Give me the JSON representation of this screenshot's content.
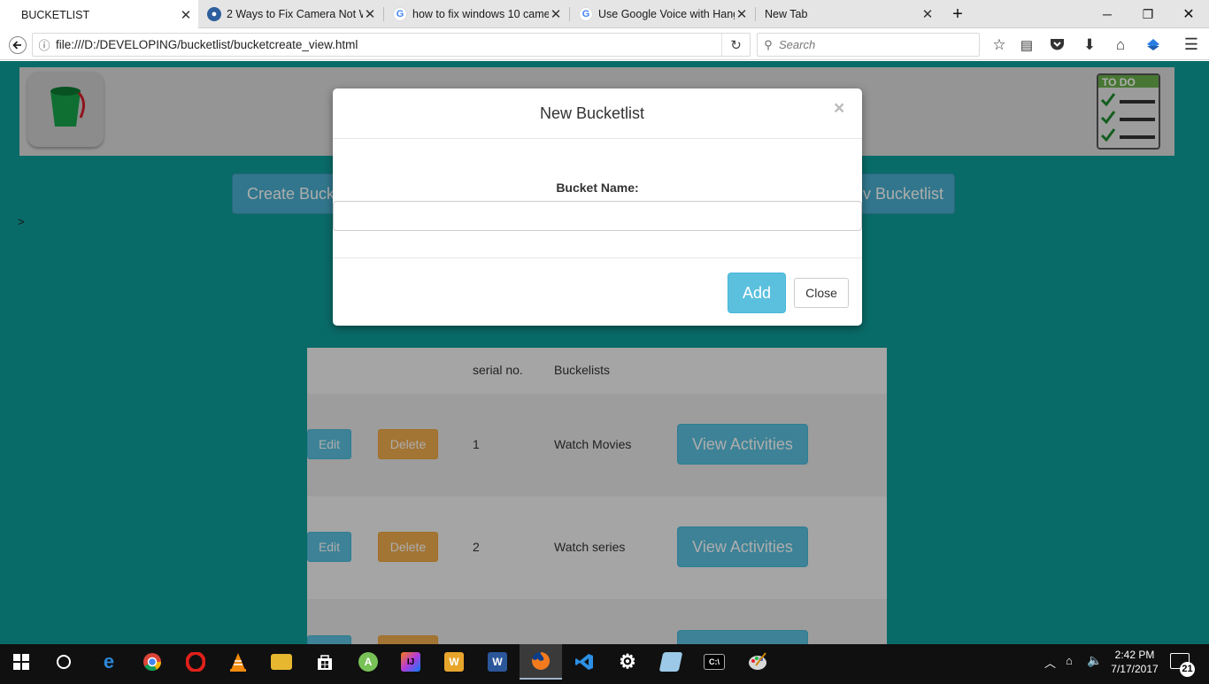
{
  "browser": {
    "tabs": [
      {
        "title": "BUCKETLIST",
        "active": true
      },
      {
        "title": "2 Ways to Fix Camera Not W",
        "active": false
      },
      {
        "title": "how to fix windows 10 came",
        "active": false
      },
      {
        "title": "Use Google Voice with Hang",
        "active": false
      },
      {
        "title": "New Tab",
        "active": false
      }
    ],
    "new_tab_glyph": "+",
    "url": "file:///D:/DEVELOPING/bucketlist/bucketcreate_view.html",
    "search_placeholder": "Search"
  },
  "page": {
    "buttons": {
      "create_label": "Create Buck",
      "view_label": "v Bucketlist"
    },
    "stray_text": ">",
    "table": {
      "headers": [
        "serial no.",
        "Buckelists"
      ],
      "rows": [
        {
          "serial": "1",
          "name": "Watch Movies",
          "edit": "Edit",
          "delete": "Delete",
          "view": "View Activities"
        },
        {
          "serial": "2",
          "name": "Watch series",
          "edit": "Edit",
          "delete": "Delete",
          "view": "View Activities"
        }
      ]
    }
  },
  "modal": {
    "title": "New Bucketlist",
    "close_glyph": "×",
    "field_label": "Bucket Name:",
    "field_value": "",
    "add_label": "Add",
    "close_label": "Close"
  },
  "taskbar": {
    "time": "2:42 PM",
    "date": "7/17/2017",
    "notifications": "21"
  },
  "colors": {
    "page_bg": "#0e9e9a",
    "info_button": "#5bc0de",
    "warning_button": "#f0ad4e"
  }
}
